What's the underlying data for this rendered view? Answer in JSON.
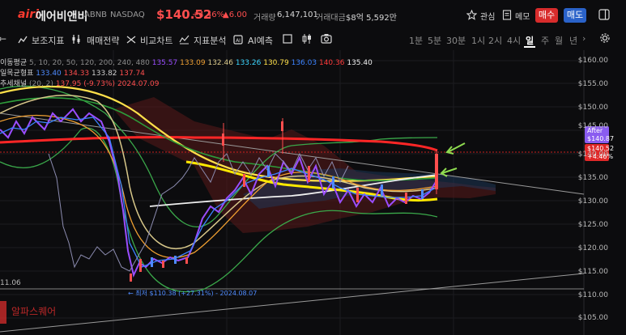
{
  "header": {
    "logo": "airi",
    "name": "에어비앤비",
    "ticker": "ABNB",
    "exchange": "NASDAQ",
    "price": "$140.52",
    "change_pct": "+4.46%",
    "change_abs": "▲6.00",
    "volume_label": "거래량",
    "volume": "6,147,101",
    "amount_label": "거래대금",
    "amount": "$8억 5,592만",
    "watch_label": "관심",
    "memo_label": "메모",
    "buy_label": "매수",
    "sell_label": "매도"
  },
  "toolbar": {
    "indicators": "보조지표",
    "strategy": "매매전략",
    "compare": "비교차트",
    "analysis": "지표분석",
    "ai": "AI예측",
    "timeframes": [
      "1분",
      "5분",
      "30분",
      "1시",
      "2시",
      "4시",
      "일",
      "주",
      "월",
      "년"
    ],
    "selected": "일"
  },
  "legend": {
    "ma_label": "이동평균",
    "ma_periods": "5, 10, 20, 50, 120, 200, 240, 480",
    "ma_values": [
      "135.57",
      "133.09",
      "132.46",
      "133.26",
      "130.79",
      "136.03",
      "140.36",
      "135.40"
    ],
    "ichimoku_label": "일목균형표",
    "ichimoku_values": [
      "133.40",
      "134.33",
      "133.82",
      "137.74"
    ],
    "trend_label": "추세채널",
    "trend_period": "(20, 2)",
    "trend_value": "137.95",
    "trend_change": "(-9.73%)",
    "trend_date": "2024.07.09"
  },
  "axis": {
    "y_labels": [
      "$160.00",
      "$155.00",
      "$150.00",
      "$145.00",
      "$140.00",
      "$135.00",
      "$130.00",
      "$125.00",
      "$120.00",
      "$115.00",
      "$110.00",
      "$105.00"
    ],
    "after_label": "After",
    "after_price": "$140.87",
    "price_tag": "$140.52",
    "price_tag_pct": "+4.46%",
    "left_level": "11.06"
  },
  "annotation": {
    "low": "← 최저 $110.38 (+27.31%) - 2024.08.07"
  },
  "watermark": "알파스퀘어",
  "colors": {
    "up": "#ff4e4e",
    "down": "#4e8bff",
    "buy": "#d82c2c",
    "sell": "#2a62c9",
    "accent_red": "#ff2626"
  }
}
